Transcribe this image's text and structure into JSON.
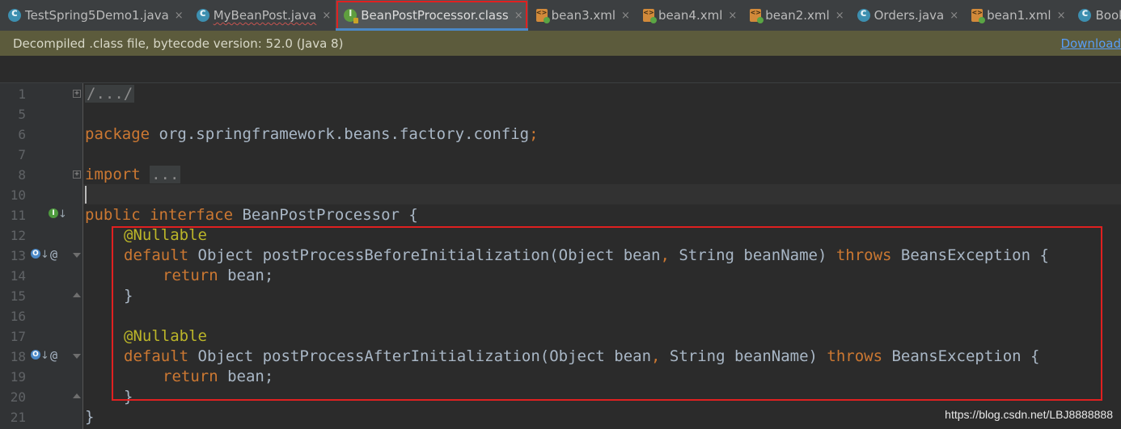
{
  "tabs": [
    {
      "label": "TestSpring5Demo1.java",
      "icon": "class-icon",
      "type": "class",
      "active": false
    },
    {
      "label": "MyBeanPost.java",
      "icon": "class-icon",
      "type": "class",
      "active": false,
      "squiggle": true
    },
    {
      "label": "BeanPostProcessor.class",
      "icon": "interface-icon",
      "type": "interface",
      "active": true
    },
    {
      "label": "bean3.xml",
      "icon": "xml-icon",
      "type": "xml",
      "active": false
    },
    {
      "label": "bean4.xml",
      "icon": "xml-icon",
      "type": "xml",
      "active": false
    },
    {
      "label": "bean2.xml",
      "icon": "xml-icon",
      "type": "xml",
      "active": false
    },
    {
      "label": "Orders.java",
      "icon": "class-icon",
      "type": "class",
      "active": false
    },
    {
      "label": "bean1.xml",
      "icon": "xml-icon",
      "type": "xml",
      "active": false
    },
    {
      "label": "Book",
      "icon": "class-icon",
      "type": "class",
      "active": false
    }
  ],
  "tab_close_glyph": "×",
  "banner": {
    "message": "Decompiled .class file, bytecode version: 52.0 (Java 8)",
    "link": "Download"
  },
  "line_numbers": [
    "1",
    "5",
    "6",
    "7",
    "8",
    "10",
    "11",
    "12",
    "13",
    "14",
    "15",
    "16",
    "17",
    "18",
    "19",
    "20",
    "21"
  ],
  "code": {
    "l1": "/.../",
    "l6_kw": "package",
    "l6_pkg": " org.springframework.beans.factory.config",
    "l6_semi": ";",
    "l8_kw": "import",
    "l8_fold": "...",
    "l11_kw1": "public",
    "l11_kw2": "interface",
    "l11_name": " BeanPostProcessor {",
    "ann": "@Nullable",
    "m1_kw": "default",
    "m1_sig": " Object postProcessBeforeInitialization(Object bean",
    "m1_sig2": " String beanName) ",
    "throws": "throws",
    "m_exc": " BeansException {",
    "ret_kw": "return",
    "ret_val": " bean;",
    "close": "}",
    "m2_sig": " Object postProcessAfterInitialization(Object bean",
    "comma": ","
  },
  "watermark": "https://blog.csdn.net/LBJ8888888",
  "colors": {
    "keyword": "#cc7832",
    "annotation": "#bbb529",
    "text": "#a9b7c6",
    "highlight": "#e02020"
  }
}
